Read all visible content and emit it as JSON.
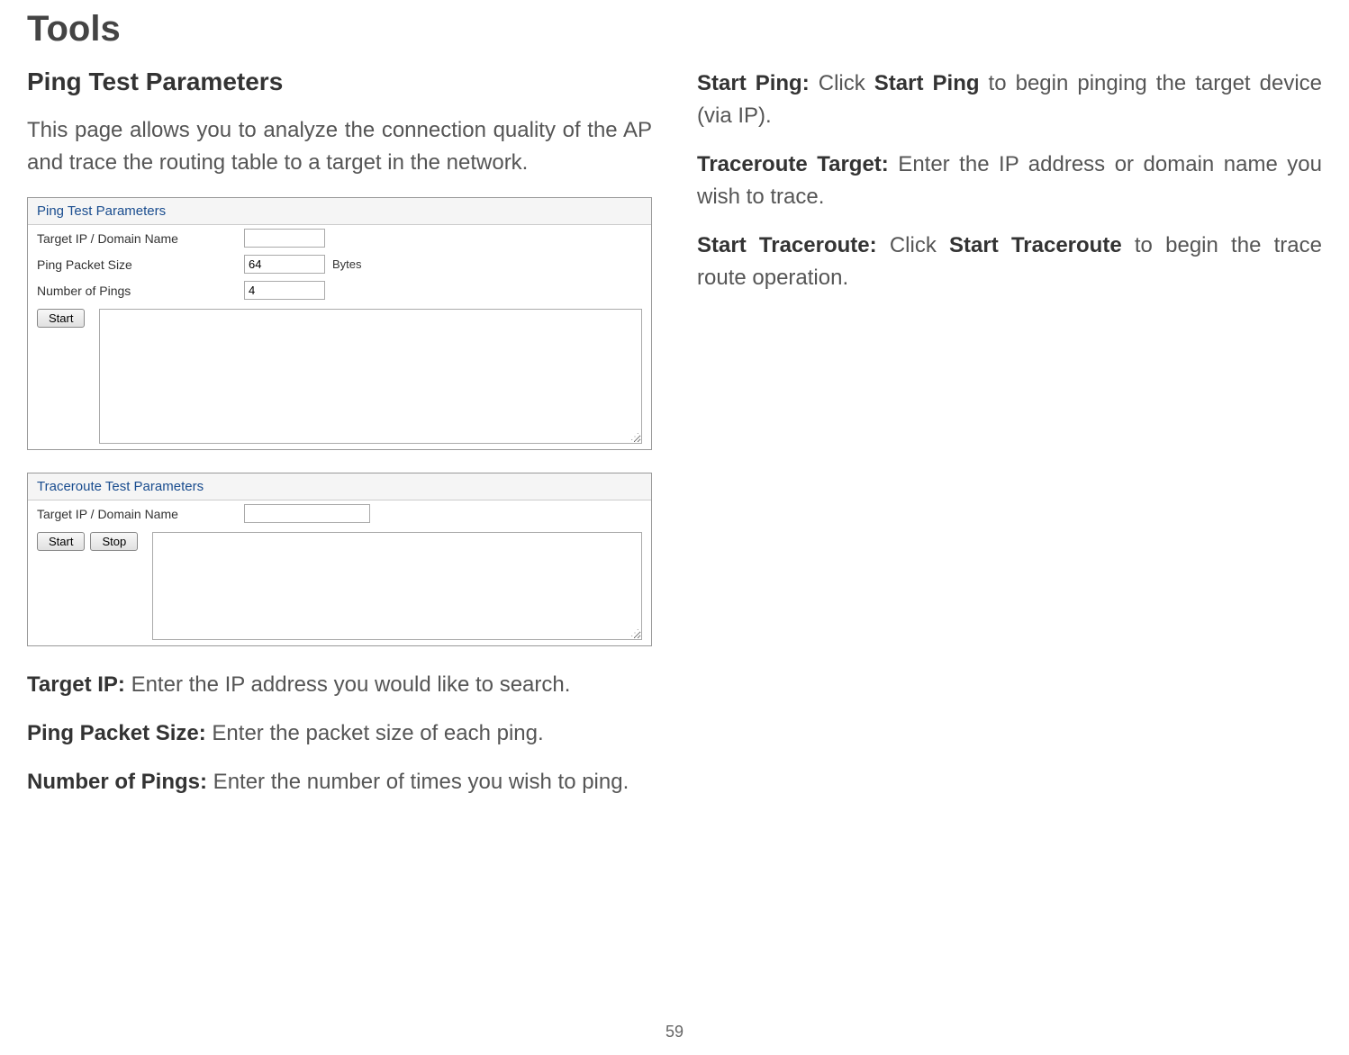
{
  "pageTitle": "Tools",
  "sectionTitle": "Ping Test Parameters",
  "introText": "This page allows you to analyze the connection quality of the AP and trace the routing table to a target in the network.",
  "pingPanel": {
    "header": "Ping Test Parameters",
    "targetLabel": "Target IP / Domain Name",
    "packetSizeLabel": "Ping Packet Size",
    "packetSizeValue": "64",
    "packetSizeUnit": "Bytes",
    "numPingsLabel": "Number of Pings",
    "numPingsValue": "4",
    "startButton": "Start"
  },
  "traceroutePanel": {
    "header": "Traceroute Test Parameters",
    "targetLabel": "Target IP / Domain Name",
    "startButton": "Start",
    "stopButton": "Stop"
  },
  "definitions": {
    "targetIp": {
      "term": "Target IP:",
      "text": " Enter the IP address you would like to search."
    },
    "pingPacketSize": {
      "term": "Ping Packet Size:",
      "text": " Enter the packet size of each ping."
    },
    "numberOfPings": {
      "term": "Number of Pings:",
      "text": " Enter the number of times you wish to ping."
    },
    "startPing": {
      "term": "Start Ping:",
      "text1": " Click ",
      "bold": "Start Ping",
      "text2": " to begin pinging the target device (via IP)."
    },
    "tracerouteTarget": {
      "term": "Traceroute Target:",
      "text": " Enter the IP address or domain name you wish to trace."
    },
    "startTraceroute": {
      "term": "Start Traceroute:",
      "text1": " Click ",
      "bold": "Start Traceroute",
      "text2": " to begin the trace route operation."
    }
  },
  "pageNumber": "59"
}
